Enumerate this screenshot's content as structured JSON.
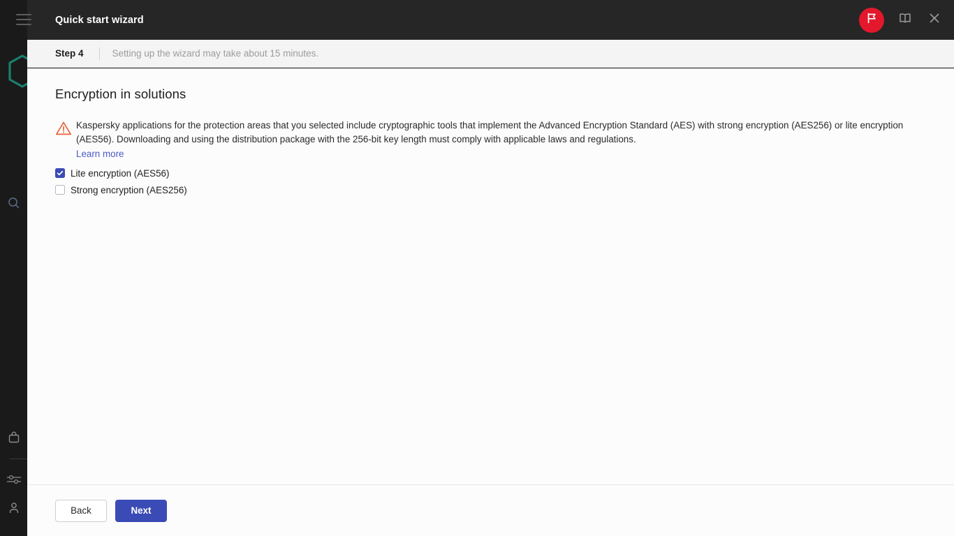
{
  "colors": {
    "sidebar_bg": "#1a1a1a",
    "header_bg": "#262626",
    "accent_blue": "#3b4bb5",
    "link_blue": "#4b5bc4",
    "badge_red": "#e3182c",
    "logo_teal": "#1d7d6c",
    "warning_orange": "#e8663c",
    "stepbar_bg": "#f4f4f4",
    "content_bg": "#fcfcfd"
  },
  "sidebar": {
    "logo_icon": "hexagon-logo-icon",
    "items": [
      {
        "icon": "search-icon",
        "name": "sidebar-item-search"
      },
      {
        "icon": "briefcase-icon",
        "name": "sidebar-item-marketplace"
      },
      {
        "icon": "sliders-icon",
        "name": "sidebar-item-settings"
      },
      {
        "icon": "user-icon",
        "name": "sidebar-item-account"
      }
    ]
  },
  "header": {
    "menu_icon": "hamburger-menu-icon",
    "title": "Quick start wizard",
    "actions": [
      {
        "icon": "flag-icon",
        "name": "feedback-flag-button"
      },
      {
        "icon": "book-icon",
        "name": "help-documentation-button"
      },
      {
        "icon": "close-icon",
        "name": "close-wizard-button"
      }
    ]
  },
  "stepbar": {
    "step_label": "Step 4",
    "description": "Setting up the wizard may take about 15 minutes."
  },
  "main": {
    "title": "Encryption in solutions",
    "warning_icon": "warning-triangle-icon",
    "notice_text": "Kaspersky applications for the protection areas that you selected include cryptographic tools that implement the Advanced Encryption Standard (AES) with strong encryption (AES256) or lite encryption (AES56). Downloading and using the distribution package with the 256-bit key length must comply with applicable laws and regulations.",
    "learn_more_label": "Learn more",
    "options": [
      {
        "label": "Lite encryption (AES56)",
        "checked": true,
        "name": "checkbox-lite-encryption"
      },
      {
        "label": "Strong encryption (AES256)",
        "checked": false,
        "name": "checkbox-strong-encryption"
      }
    ]
  },
  "footer": {
    "back_label": "Back",
    "next_label": "Next"
  }
}
